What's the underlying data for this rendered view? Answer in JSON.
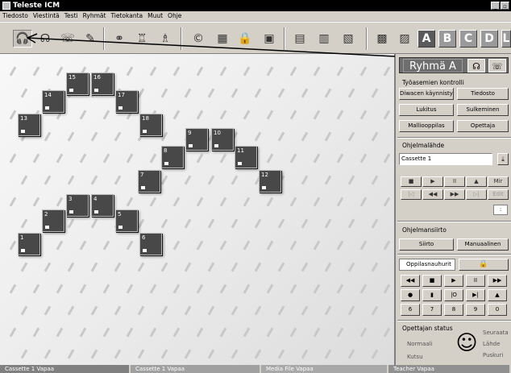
{
  "window": {
    "title": "Teleste ICM"
  },
  "menu": [
    "Tiedosto",
    "Viestintä",
    "Testi",
    "Ryhmät",
    "Tietokanta",
    "Muut",
    "Ohje"
  ],
  "toolbar": {
    "group_letters": [
      "A",
      "B",
      "C",
      "D",
      "L"
    ],
    "active_group": "A",
    "icons": [
      "monitor-headset-icon",
      "listen-icon",
      "talk-icon",
      "write-icon",
      "pair-icon",
      "bottle-icon",
      "group-talk-icon",
      "copyright-icon",
      "media-transfer-icon",
      "lock-icon",
      "tape-icon",
      "tape-copy-icon",
      "tape-group-icon",
      "tape-all-icon",
      "grid-view-icon",
      "list-view-icon"
    ]
  },
  "stations": [
    {
      "n": "1"
    },
    {
      "n": "2"
    },
    {
      "n": "3"
    },
    {
      "n": "4"
    },
    {
      "n": "5"
    },
    {
      "n": "6"
    },
    {
      "n": "7"
    },
    {
      "n": "8"
    },
    {
      "n": "9"
    },
    {
      "n": "10"
    },
    {
      "n": "11"
    },
    {
      "n": "12"
    },
    {
      "n": "13"
    },
    {
      "n": "14"
    },
    {
      "n": "15"
    },
    {
      "n": "16"
    },
    {
      "n": "17"
    },
    {
      "n": "18"
    }
  ],
  "panel": {
    "group_title": "Ryhmä A",
    "work_control": {
      "heading": "Työasemien kontrolli",
      "buttons": [
        "Diwacen käynnistys",
        "Tiedosto",
        "Lukitus",
        "Sulkeminen",
        "Malliooppilas",
        "Opettaja"
      ]
    },
    "program_source": {
      "heading": "Ohjelmalähde",
      "value": "Cassette 1",
      "controls_row1": [
        "■",
        "▶",
        "II",
        "▲",
        "Mir"
      ],
      "controls_row2": [
        "|◁",
        "◀◀",
        "▶▶",
        "▷|",
        "Edit"
      ],
      "counter": ":"
    },
    "program_transfer": {
      "heading": "Ohjelmansiirto",
      "buttons": [
        "Siirto",
        "Manuaalinen"
      ]
    },
    "recorder": {
      "tab_label": "Oppilasnauhurit",
      "row1": [
        "◀◀",
        "■",
        "▶",
        "II",
        "▶▶"
      ],
      "row2": [
        "●",
        "▮",
        "|O",
        "▶|",
        "▲"
      ],
      "row3": [
        "6",
        "7",
        "8",
        "9",
        "0"
      ]
    },
    "teacher_status": {
      "heading": "Opettajan status",
      "left": [
        "Normaali",
        "Kutsu"
      ],
      "right": [
        "Seuraata",
        "Lähde",
        "Puskuri"
      ]
    }
  },
  "statusbar": [
    {
      "label": "Cassette 1 Vapaa",
      "color": "#808080"
    },
    {
      "label": "Cassette 1 Vapaa",
      "color": "#a0a0a0"
    },
    {
      "label": "Media File Vapaa",
      "color": "#a8a8a8"
    },
    {
      "label": "Teacher Vapaa",
      "color": "#909090"
    }
  ]
}
